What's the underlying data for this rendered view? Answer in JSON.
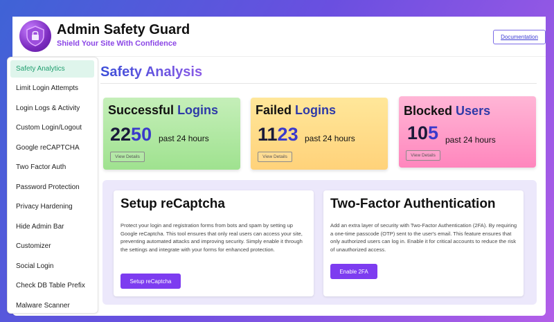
{
  "header": {
    "title": "Admin Safety Guard",
    "subtitle": "Shield Your Site With Confidence",
    "documentation_label": "Documentation",
    "logo_icon": "shield-lock-icon"
  },
  "sidebar": {
    "items": [
      {
        "label": "Safety Analytics",
        "active": true
      },
      {
        "label": "Limit Login Attempts"
      },
      {
        "label": "Login Logs & Activity"
      },
      {
        "label": "Custom Login/Logout"
      },
      {
        "label": "Google reCAPTCHA"
      },
      {
        "label": "Two Factor Auth"
      },
      {
        "label": "Password Protection"
      },
      {
        "label": "Privacy Hardening"
      },
      {
        "label": "Hide Admin Bar"
      },
      {
        "label": "Customizer"
      },
      {
        "label": "Social Login"
      },
      {
        "label": "Check DB Table Prefix"
      },
      {
        "label": "Malware Scanner"
      }
    ]
  },
  "main": {
    "title": "Safety Analysis",
    "stats": [
      {
        "title_a": "Successful",
        "title_b": "Logins",
        "value_a": "22",
        "value_b": "50",
        "caption": "past 24 hours",
        "button": "View Details",
        "color": "#a8e59a"
      },
      {
        "title_a": "Failed",
        "title_b": "Logins",
        "value_a": "11",
        "value_b": "23",
        "caption": "past 24 hours",
        "button": "View Details",
        "color": "#ffdc85"
      },
      {
        "title_a": "Blocked",
        "title_b": "Users",
        "value_a": "10",
        "value_b": "5",
        "caption": "past 24 hours",
        "button": "View Details",
        "color": "#ff9cc8"
      }
    ],
    "cards": [
      {
        "title": "Setup reCaptcha",
        "body": "Protect your login and registration forms from bots and spam by setting up Google reCaptcha. This tool ensures that only real users can access your site, preventing automated attacks and improving security. Simply enable it through the settings and integrate with your forms for enhanced protection.",
        "button": "Setup reCaptcha"
      },
      {
        "title": "Two-Factor Authentication",
        "body": "Add an extra layer of security with Two-Factor Authentication (2FA). By requiring a one-time passcode (OTP) sent to the user's email. This feature ensures that only authorized users can log in. Enable it for critical accounts to reduce the risk of unauthorized access.",
        "button": "Enable 2FA"
      }
    ]
  },
  "colors": {
    "accent": "#7d3cf0",
    "active_nav_bg": "#dff5ec",
    "active_nav_text": "#1f9e6e"
  }
}
